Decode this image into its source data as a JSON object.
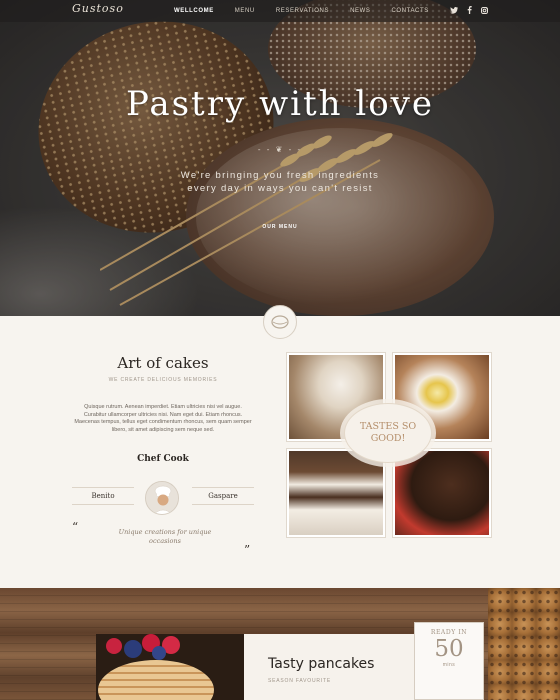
{
  "nav": {
    "logo": "Gustoso",
    "items": [
      {
        "label": "WELLCOME",
        "active": true
      },
      {
        "label": "MENU",
        "active": false
      },
      {
        "label": "RESERVATIONS",
        "active": false
      },
      {
        "label": "NEWS",
        "active": false
      },
      {
        "label": "CONTACTS",
        "active": false
      }
    ],
    "social": [
      "twitter-icon",
      "facebook-icon",
      "instagram-icon"
    ],
    "social_glyphs": {
      "twitter": "ᴛ",
      "facebook": "f",
      "instagram": "◎"
    }
  },
  "hero": {
    "title": "Pastry with love",
    "ornament": "- - ❦ - -",
    "subtitle_line1": "We're bringing you fresh ingredients",
    "subtitle_line2": "every day in ways you can't resist",
    "button": "OUR MENU"
  },
  "about": {
    "title": "Art of cakes",
    "subtitle": "WE CREATE DELICIOUS MEMORIES",
    "text": "Quisque rutrum. Aenean imperdiet. Etiam ultricies nisi vel augue. Curabitur ullamcorper ultricies nisi. Nam eget dui. Etiam rhoncus. Maecenas tempus, tellus eget condimentum rhoncus, sem quam semper libero, sit amet adipiscing sem neque sed.",
    "chef_title": "Chef Cook",
    "chef_first": "Benito",
    "chef_last": "Gaspare",
    "quote_open": "“",
    "quote_close": "”",
    "signature": "Unique creations for unique occasions",
    "badge": "TASTES SO GOOD!"
  },
  "promo": {
    "title": "Tasty pancakes",
    "subtitle": "SEASON FAVOURITE",
    "ready_label": "READY IN",
    "ready_value": "50",
    "ready_unit": "mins"
  },
  "colors": {
    "accent": "#b48e6a",
    "dark_text": "#2b2622",
    "muted_text": "#a0968b"
  }
}
